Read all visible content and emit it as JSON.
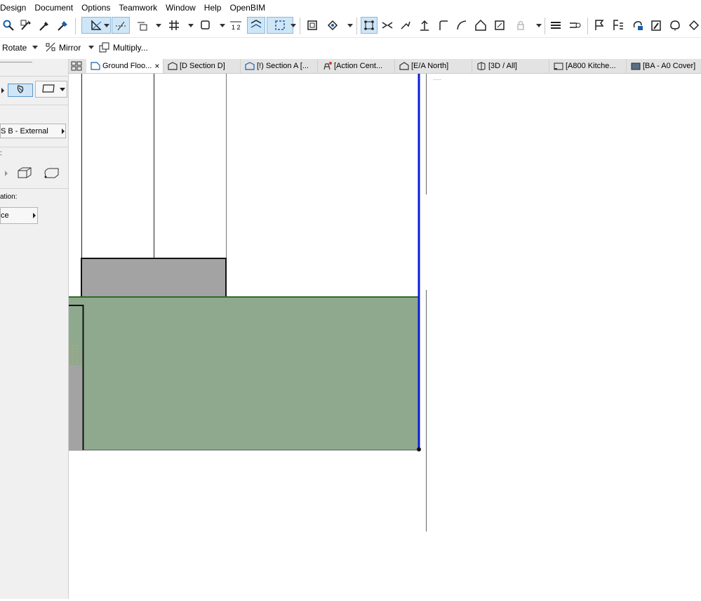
{
  "menu": [
    "Design",
    "Document",
    "Options",
    "Teamwork",
    "Window",
    "Help",
    "OpenBIM"
  ],
  "toolbar2": {
    "rotate_label": "Rotate",
    "mirror_label": "Mirror",
    "multiply_label": "Multiply..."
  },
  "tabs": [
    {
      "label": "Ground Floo...",
      "icon": "floor-plan-icon",
      "close": "×"
    },
    {
      "label": "[D Section D]",
      "icon": "section-icon"
    },
    {
      "label": "[!) Section A [...",
      "icon": "section-icon"
    },
    {
      "label": "[Action Cent...",
      "icon": "action-center-icon"
    },
    {
      "label": "[E/A North]",
      "icon": "elevation-icon"
    },
    {
      "label": "[3D / All]",
      "icon": "3d-icon"
    },
    {
      "label": "[A800 Kitche...",
      "icon": "layout-icon"
    },
    {
      "label": "[BA - A0 Cover]",
      "icon": "layout-icon"
    }
  ],
  "left_panel": {
    "composite_label": "S B - External",
    "section_label": "ation:",
    "ref_label": "ce"
  },
  "canvas": {
    "dash_note": "----",
    "colors": {
      "fill_green": "#8fa98e",
      "fill_grey": "#a3a3a3",
      "edge_blue": "#0b1bd8",
      "edge_green": "#2e6b24"
    }
  }
}
